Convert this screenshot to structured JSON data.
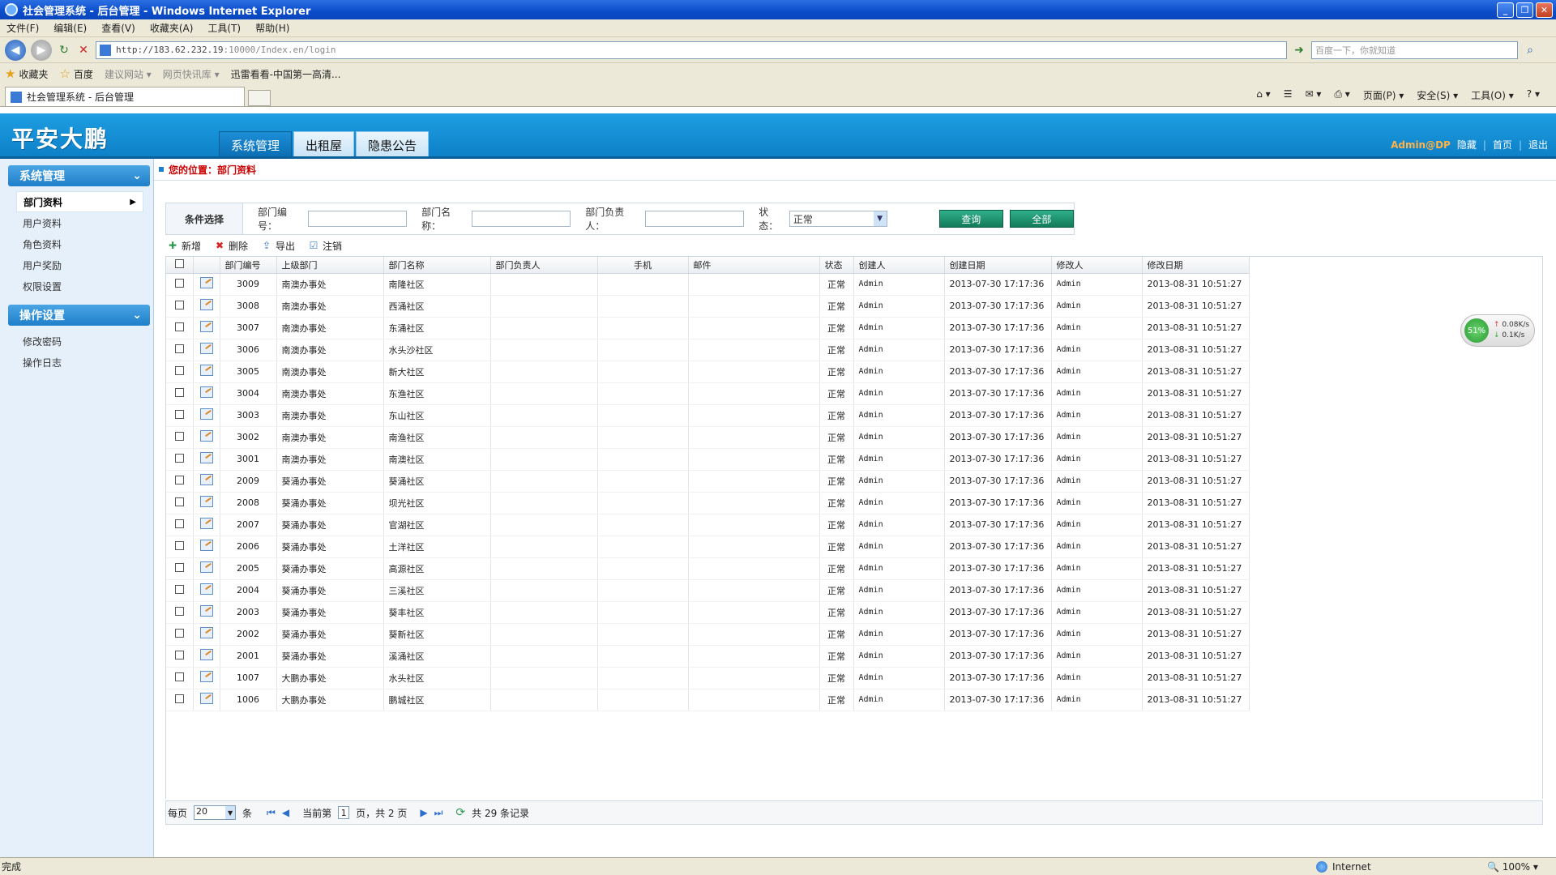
{
  "window": {
    "title": "社会管理系统 - 后台管理 - Windows Internet Explorer"
  },
  "menu": [
    "文件(F)",
    "编辑(E)",
    "查看(V)",
    "收藏夹(A)",
    "工具(T)",
    "帮助(H)"
  ],
  "address": {
    "url": "http://183.62.232.19",
    "url_suffix": ":10000/Index.en/login",
    "search_placeholder": "百度一下，你就知道"
  },
  "favorites": {
    "label": "收藏夹",
    "items": [
      "百度",
      "建议网站 ▾",
      "网页快讯库 ▾",
      "迅雷看看-中国第一高清..."
    ]
  },
  "tab": {
    "title": "社会管理系统 - 后台管理"
  },
  "commands": [
    "页面(P) ▾",
    "安全(S) ▾",
    "工具(O) ▾"
  ],
  "app": {
    "logo": "平安大鹏",
    "topnav": [
      "系统管理",
      "出租屋",
      "隐患公告"
    ],
    "user": "Admin@DP",
    "top_links": [
      "隐藏",
      "首页",
      "退出"
    ]
  },
  "sidebar": {
    "sections": [
      {
        "title": "系统管理",
        "items": [
          "部门资料",
          "用户资料",
          "角色资料",
          "用户奖励",
          "权限设置"
        ]
      },
      {
        "title": "操作设置",
        "items": [
          "修改密码",
          "操作日志"
        ]
      }
    ]
  },
  "breadcrumb": "您的位置：部门资料",
  "filter": {
    "label": "条件选择",
    "dept_no": "部门编号：",
    "dept_name": "部门名称：",
    "dept_head": "部门负责人：",
    "status_label": "状态：",
    "status_value": "正常",
    "query": "查询",
    "all": "全部"
  },
  "toolbar": [
    "新增",
    "删除",
    "导出",
    "注销"
  ],
  "grid": {
    "columns": [
      "部门编号",
      "上级部门",
      "部门名称",
      "部门负责人",
      "手机",
      "邮件",
      "状态",
      "创建人",
      "创建日期",
      "修改人",
      "修改日期"
    ],
    "rows": [
      [
        "3009",
        "南澳办事处",
        "南隆社区",
        "",
        "",
        "",
        "正常",
        "Admin",
        "2013-07-30 17:17:36",
        "Admin",
        "2013-08-31 10:51:27"
      ],
      [
        "3008",
        "南澳办事处",
        "西涌社区",
        "",
        "",
        "",
        "正常",
        "Admin",
        "2013-07-30 17:17:36",
        "Admin",
        "2013-08-31 10:51:27"
      ],
      [
        "3007",
        "南澳办事处",
        "东涌社区",
        "",
        "",
        "",
        "正常",
        "Admin",
        "2013-07-30 17:17:36",
        "Admin",
        "2013-08-31 10:51:27"
      ],
      [
        "3006",
        "南澳办事处",
        "水头沙社区",
        "",
        "",
        "",
        "正常",
        "Admin",
        "2013-07-30 17:17:36",
        "Admin",
        "2013-08-31 10:51:27"
      ],
      [
        "3005",
        "南澳办事处",
        "新大社区",
        "",
        "",
        "",
        "正常",
        "Admin",
        "2013-07-30 17:17:36",
        "Admin",
        "2013-08-31 10:51:27"
      ],
      [
        "3004",
        "南澳办事处",
        "东渔社区",
        "",
        "",
        "",
        "正常",
        "Admin",
        "2013-07-30 17:17:36",
        "Admin",
        "2013-08-31 10:51:27"
      ],
      [
        "3003",
        "南澳办事处",
        "东山社区",
        "",
        "",
        "",
        "正常",
        "Admin",
        "2013-07-30 17:17:36",
        "Admin",
        "2013-08-31 10:51:27"
      ],
      [
        "3002",
        "南澳办事处",
        "南渔社区",
        "",
        "",
        "",
        "正常",
        "Admin",
        "2013-07-30 17:17:36",
        "Admin",
        "2013-08-31 10:51:27"
      ],
      [
        "3001",
        "南澳办事处",
        "南澳社区",
        "",
        "",
        "",
        "正常",
        "Admin",
        "2013-07-30 17:17:36",
        "Admin",
        "2013-08-31 10:51:27"
      ],
      [
        "2009",
        "葵涌办事处",
        "葵涌社区",
        "",
        "",
        "",
        "正常",
        "Admin",
        "2013-07-30 17:17:36",
        "Admin",
        "2013-08-31 10:51:27"
      ],
      [
        "2008",
        "葵涌办事处",
        "坝光社区",
        "",
        "",
        "",
        "正常",
        "Admin",
        "2013-07-30 17:17:36",
        "Admin",
        "2013-08-31 10:51:27"
      ],
      [
        "2007",
        "葵涌办事处",
        "官湖社区",
        "",
        "",
        "",
        "正常",
        "Admin",
        "2013-07-30 17:17:36",
        "Admin",
        "2013-08-31 10:51:27"
      ],
      [
        "2006",
        "葵涌办事处",
        "土洋社区",
        "",
        "",
        "",
        "正常",
        "Admin",
        "2013-07-30 17:17:36",
        "Admin",
        "2013-08-31 10:51:27"
      ],
      [
        "2005",
        "葵涌办事处",
        "高源社区",
        "",
        "",
        "",
        "正常",
        "Admin",
        "2013-07-30 17:17:36",
        "Admin",
        "2013-08-31 10:51:27"
      ],
      [
        "2004",
        "葵涌办事处",
        "三溪社区",
        "",
        "",
        "",
        "正常",
        "Admin",
        "2013-07-30 17:17:36",
        "Admin",
        "2013-08-31 10:51:27"
      ],
      [
        "2003",
        "葵涌办事处",
        "葵丰社区",
        "",
        "",
        "",
        "正常",
        "Admin",
        "2013-07-30 17:17:36",
        "Admin",
        "2013-08-31 10:51:27"
      ],
      [
        "2002",
        "葵涌办事处",
        "葵新社区",
        "",
        "",
        "",
        "正常",
        "Admin",
        "2013-07-30 17:17:36",
        "Admin",
        "2013-08-31 10:51:27"
      ],
      [
        "2001",
        "葵涌办事处",
        "溪涌社区",
        "",
        "",
        "",
        "正常",
        "Admin",
        "2013-07-30 17:17:36",
        "Admin",
        "2013-08-31 10:51:27"
      ],
      [
        "1007",
        "大鹏办事处",
        "水头社区",
        "",
        "",
        "",
        "正常",
        "Admin",
        "2013-07-30 17:17:36",
        "Admin",
        "2013-08-31 10:51:27"
      ],
      [
        "1006",
        "大鹏办事处",
        "鹏城社区",
        "",
        "",
        "",
        "正常",
        "Admin",
        "2013-07-30 17:17:36",
        "Admin",
        "2013-08-31 10:51:27"
      ]
    ]
  },
  "pager": {
    "per_page_label": "每页",
    "per_page": "20",
    "unit": "条",
    "current_label": "当前第",
    "current_page": "1",
    "of_label": "页，共 2 页",
    "total": "共 29 条记录"
  },
  "speed": {
    "percent": "51%",
    "up": "0.08K/s",
    "down": "0.1K/s"
  },
  "status": {
    "left": "完成",
    "zone": "Internet",
    "zoom": "100%"
  }
}
